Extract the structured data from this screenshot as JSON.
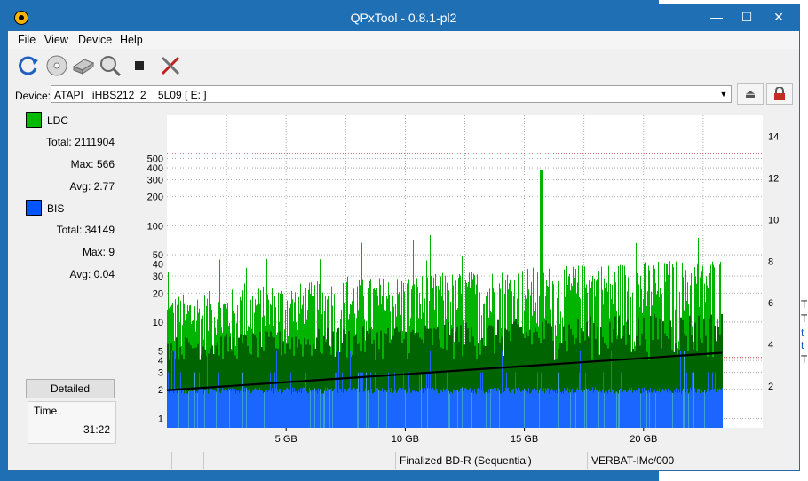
{
  "window": {
    "title": "QPxTool - 0.8.1-pl2",
    "minimize": "—",
    "maximize": "☐",
    "close": "✕"
  },
  "menu": [
    "File",
    "View",
    "Device",
    "Help"
  ],
  "toolbar": {
    "icons": [
      "refresh-icon",
      "disc-info-icon",
      "drive-icon",
      "disc-scan-icon",
      "stop-icon",
      "tools-icon"
    ]
  },
  "device": {
    "label": "Device:",
    "value": "ATAPI   iHBS212  2    5L09 [ E: ]"
  },
  "stats": {
    "ldc": {
      "name": "LDC",
      "color": "#00bb00",
      "total": "Total: 2111904",
      "max": "Max: 566",
      "avg": "Avg: 2.77"
    },
    "bis": {
      "name": "BIS",
      "color": "#0055ff",
      "total": "Total: 34149",
      "max": "Max: 9",
      "avg": "Avg: 0.04"
    }
  },
  "detailed_button": "Detailed",
  "time": {
    "label": "Time",
    "value": "31:22"
  },
  "status": {
    "disc_type": "Finalized BD-R (Sequential)",
    "media_id": "VERBAT-IMc/000"
  },
  "chart_data": {
    "type": "bar",
    "x_ticks": [
      "5 GB",
      "10 GB",
      "15 GB",
      "20 GB"
    ],
    "x_tick_values": [
      5,
      10,
      15,
      20
    ],
    "xlim": [
      0,
      25
    ],
    "data_end_gb": 23.3,
    "y_left_ticks": [
      1,
      2,
      3,
      4,
      5,
      10,
      20,
      30,
      40,
      50,
      100,
      200,
      300,
      400,
      500
    ],
    "y_left_scale": "log",
    "y_right_ticks": [
      2,
      4,
      6,
      8,
      10,
      12,
      14
    ],
    "y_right_range": [
      0,
      15
    ],
    "series": [
      {
        "name": "LDC",
        "color": "#00c000",
        "typical_peak": 40,
        "max": 566
      },
      {
        "name": "BIS",
        "color": "#1a66ff",
        "typical": 2,
        "max": 9
      },
      {
        "name": "speed",
        "color": "#000000",
        "start": 1.8,
        "end": 3.6
      }
    ],
    "grid": true
  },
  "bg": {
    "lines": [
      "T",
      "T",
      "t",
      "t",
      "T"
    ]
  }
}
